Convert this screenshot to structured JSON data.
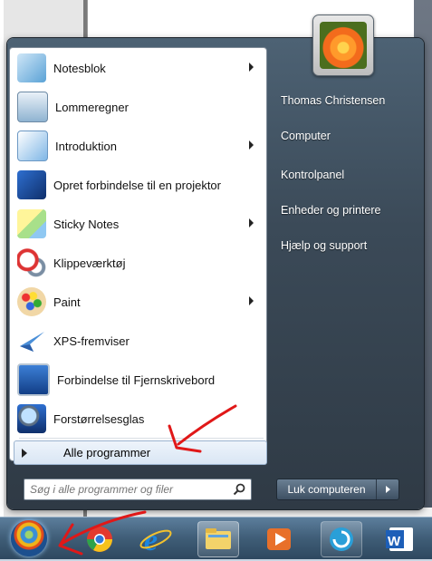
{
  "left_pane": {
    "programs": [
      {
        "label": "Notesblok",
        "has_submenu": true,
        "icon": "notepad-icon"
      },
      {
        "label": "Lommeregner",
        "has_submenu": false,
        "icon": "calculator-icon"
      },
      {
        "label": "Introduktion",
        "has_submenu": true,
        "icon": "getting-started-icon"
      },
      {
        "label": "Opret forbindelse til en projektor",
        "has_submenu": false,
        "icon": "projector-icon"
      },
      {
        "label": "Sticky Notes",
        "has_submenu": true,
        "icon": "sticky-notes-icon"
      },
      {
        "label": "Klippeværktøj",
        "has_submenu": false,
        "icon": "snipping-tool-icon"
      },
      {
        "label": "Paint",
        "has_submenu": true,
        "icon": "paint-icon"
      },
      {
        "label": "XPS-fremviser",
        "has_submenu": false,
        "icon": "xps-viewer-icon"
      },
      {
        "label": "Forbindelse til Fjernskrivebord",
        "has_submenu": false,
        "icon": "remote-desktop-icon"
      },
      {
        "label": "Forstørrelsesglas",
        "has_submenu": false,
        "icon": "magnifier-icon"
      }
    ],
    "all_programs_label": "Alle programmer",
    "search_placeholder": "Søg i alle programmer og filer"
  },
  "right_pane": {
    "user_name": "Thomas Christensen",
    "links": [
      "Computer",
      "Kontrolpanel",
      "Enheder og printere",
      "Hjælp og support"
    ],
    "shutdown_label": "Luk computeren"
  },
  "taskbar": {
    "pinned": [
      "windows-start-orb",
      "chrome-icon",
      "internet-explorer-icon",
      "file-explorer-icon",
      "media-player-icon",
      "browser-icon",
      "word-icon"
    ]
  },
  "colors": {
    "annotation": "#e01818",
    "menu_dark": "#3b4a58",
    "highlight": "#d9e6f4"
  }
}
